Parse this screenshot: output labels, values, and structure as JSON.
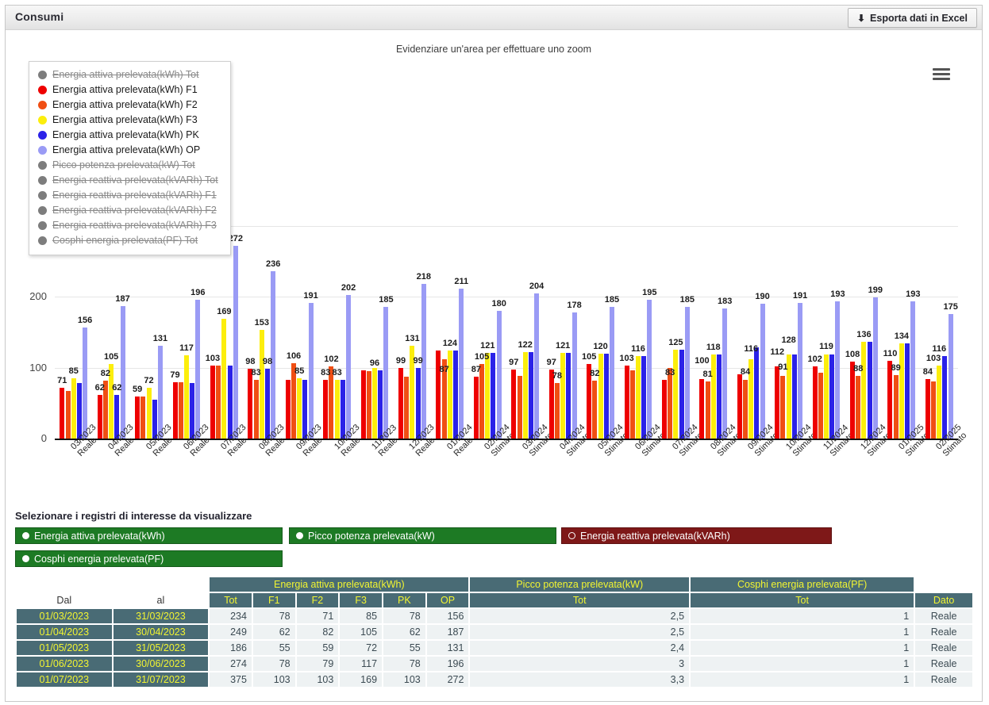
{
  "panel": {
    "title": "Consumi"
  },
  "toolbar": {
    "export_label": "Esporta dati in Excel",
    "export_icon": "download-icon",
    "menu_icon": "hamburger-menu-icon"
  },
  "chart_hint": "Evidenziare un'area per effettuare uno zoom",
  "legend": {
    "items": [
      {
        "label": "Energia attiva prelevata(kWh) Tot",
        "color": "#7d7d7d",
        "active": false
      },
      {
        "label": "Energia attiva prelevata(kWh) F1",
        "color": "#ee0000",
        "active": true
      },
      {
        "label": "Energia attiva prelevata(kWh) F2",
        "color": "#f04e13",
        "active": true
      },
      {
        "label": "Energia attiva prelevata(kWh) F3",
        "color": "#fcee0c",
        "active": true
      },
      {
        "label": "Energia attiva prelevata(kWh) PK",
        "color": "#2b22e8",
        "active": true
      },
      {
        "label": "Energia attiva prelevata(kWh) OP",
        "color": "#9a9bf5",
        "active": true
      },
      {
        "label": "Picco potenza prelevata(kW) Tot",
        "color": "#7d7d7d",
        "active": false
      },
      {
        "label": "Energia reattiva prelevata(kVARh) Tot",
        "color": "#7d7d7d",
        "active": false
      },
      {
        "label": "Energia reattiva prelevata(kVARh) F1",
        "color": "#7d7d7d",
        "active": false
      },
      {
        "label": "Energia reattiva prelevata(kVARh) F2",
        "color": "#7d7d7d",
        "active": false
      },
      {
        "label": "Energia reattiva prelevata(kVARh) F3",
        "color": "#7d7d7d",
        "active": false
      },
      {
        "label": "Cosphi energia prelevata(PF) Tot",
        "color": "#7d7d7d",
        "active": false
      }
    ]
  },
  "chart_data": {
    "type": "bar",
    "title": "",
    "xlabel": "",
    "ylabel": "",
    "ylim": [
      0,
      300
    ],
    "yticks": [
      0,
      100,
      200,
      300
    ],
    "grid": true,
    "legend_position": "top-left-overlay",
    "categories": [
      "03/2023\nReale",
      "04/2023\nReale",
      "05/2023\nReale",
      "06/2023\nReale",
      "07/2023\nReale",
      "08/2023\nReale",
      "09/2023\nReale",
      "10/2023\nReale",
      "11/2023\nReale",
      "12/2023\nReale",
      "01/2024\nReale",
      "02/2024\nStimato",
      "03/2024\nStimato",
      "04/2024\nStimato",
      "05/2024\nStimato",
      "06/2024\nStimato",
      "07/2024\nStimato",
      "08/2024\nStimato",
      "09/2024\nStimato",
      "10/2024\nStimato",
      "11/2024\nStimato",
      "12/2024\nStimato",
      "01/2025\nStimato",
      "02/2025\nStimato"
    ],
    "series": [
      {
        "name": "Energia attiva prelevata(kWh) F1",
        "color": "#ee0000",
        "values": [
          71,
          62,
          59,
          79,
          103,
          98,
          83,
          83,
          96,
          99,
          124,
          87,
          97,
          97,
          105,
          103,
          83,
          84,
          91,
          102,
          102,
          108,
          110,
          84
        ]
      },
      {
        "name": "Energia attiva prelevata(kWh) F2",
        "color": "#f04e13",
        "values": [
          67,
          82,
          59,
          79,
          103,
          83,
          106,
          102,
          95,
          87,
          112,
          105,
          88,
          78,
          82,
          96,
          100,
          81,
          83,
          88,
          93,
          88,
          89,
          80
        ]
      },
      {
        "name": "Energia attiva prelevata(kWh) F3",
        "color": "#fcee0c",
        "values": [
          85,
          105,
          72,
          117,
          169,
          153,
          85,
          83,
          99,
          131,
          124,
          121,
          122,
          121,
          120,
          116,
          125,
          118,
          112,
          119,
          119,
          136,
          134,
          103
        ]
      },
      {
        "name": "Energia attiva prelevata(kWh) PK",
        "color": "#2b22e8",
        "values": [
          78,
          62,
          55,
          78,
          103,
          98,
          83,
          83,
          96,
          99,
          124,
          121,
          122,
          121,
          120,
          116,
          125,
          118,
          128,
          119,
          119,
          136,
          134,
          116
        ]
      },
      {
        "name": "Energia attiva prelevata(kWh) OP",
        "color": "#9a9bf5",
        "values": [
          156,
          187,
          131,
          196,
          272,
          236,
          191,
          202,
          185,
          218,
          211,
          180,
          204,
          178,
          185,
          195,
          185,
          183,
          190,
          191,
          193,
          199,
          193,
          175
        ]
      }
    ],
    "visible_data_labels": [
      {
        "i": 0,
        "labels": [
          {
            "s": "F1",
            "v": 71
          },
          {
            "s": "F3",
            "v": 85
          },
          {
            "s": "OP",
            "v": 156
          }
        ]
      },
      {
        "i": 1,
        "labels": [
          {
            "s": "F1",
            "v": 62
          },
          {
            "s": "F2",
            "v": 82
          },
          {
            "s": "F3",
            "v": 105
          },
          {
            "s": "PK",
            "v": 62
          },
          {
            "s": "OP",
            "v": 187
          }
        ]
      },
      {
        "i": 2,
        "labels": [
          {
            "s": "F1",
            "v": 59
          },
          {
            "s": "F3",
            "v": 72
          },
          {
            "s": "OP",
            "v": 131
          }
        ]
      },
      {
        "i": 3,
        "labels": [
          {
            "s": "F1",
            "v": 79
          },
          {
            "s": "F3",
            "v": 117
          },
          {
            "s": "OP",
            "v": 196
          }
        ]
      },
      {
        "i": 4,
        "labels": [
          {
            "s": "F1",
            "v": 103
          },
          {
            "s": "F3",
            "v": 169
          },
          {
            "s": "OP",
            "v": 272
          }
        ]
      },
      {
        "i": 5,
        "labels": [
          {
            "s": "F1",
            "v": 98
          },
          {
            "s": "F2",
            "v": 83
          },
          {
            "s": "F3",
            "v": 153
          },
          {
            "s": "PK",
            "v": 98
          },
          {
            "s": "OP",
            "v": 236
          }
        ]
      },
      {
        "i": 6,
        "labels": [
          {
            "s": "F2",
            "v": 106
          },
          {
            "s": "F3",
            "v": 85
          },
          {
            "s": "OP",
            "v": 191
          }
        ]
      },
      {
        "i": 7,
        "labels": [
          {
            "s": "F1",
            "v": 83
          },
          {
            "s": "F2",
            "v": 102
          },
          {
            "s": "F3",
            "v": 83
          },
          {
            "s": "OP",
            "v": 202
          }
        ]
      },
      {
        "i": 8,
        "labels": [
          {
            "s": "F3",
            "v": 96
          },
          {
            "s": "OP",
            "v": 185
          }
        ]
      },
      {
        "i": 9,
        "labels": [
          {
            "s": "F1",
            "v": 99
          },
          {
            "s": "F3",
            "v": 131
          },
          {
            "s": "PK",
            "v": 99
          },
          {
            "s": "OP",
            "v": 218
          }
        ]
      },
      {
        "i": 10,
        "labels": [
          {
            "s": "F2",
            "v": 87
          },
          {
            "s": "F3",
            "v": 124
          },
          {
            "s": "OP",
            "v": 211
          }
        ]
      },
      {
        "i": 11,
        "labels": [
          {
            "s": "F1",
            "v": 87
          },
          {
            "s": "F2",
            "v": 105
          },
          {
            "s": "F3",
            "v": 121
          },
          {
            "s": "OP",
            "v": 180
          }
        ]
      },
      {
        "i": 12,
        "labels": [
          {
            "s": "F1",
            "v": 97
          },
          {
            "s": "F3",
            "v": 122
          },
          {
            "s": "OP",
            "v": 204
          }
        ]
      },
      {
        "i": 13,
        "labels": [
          {
            "s": "F1",
            "v": 97
          },
          {
            "s": "F2",
            "v": 78
          },
          {
            "s": "F3",
            "v": 121
          },
          {
            "s": "OP",
            "v": 178
          }
        ]
      },
      {
        "i": 14,
        "labels": [
          {
            "s": "F1",
            "v": 105
          },
          {
            "s": "F2",
            "v": 82
          },
          {
            "s": "F3",
            "v": 120
          },
          {
            "s": "OP",
            "v": 185
          }
        ]
      },
      {
        "i": 15,
        "labels": [
          {
            "s": "F1",
            "v": 103
          },
          {
            "s": "F3",
            "v": 116
          },
          {
            "s": "OP",
            "v": 195
          }
        ]
      },
      {
        "i": 16,
        "labels": [
          {
            "s": "F2",
            "v": 83
          },
          {
            "s": "F3",
            "v": 125
          },
          {
            "s": "OP",
            "v": 185
          }
        ]
      },
      {
        "i": 17,
        "labels": [
          {
            "s": "F1",
            "v": 100
          },
          {
            "s": "F2",
            "v": 81
          },
          {
            "s": "F3",
            "v": 118
          },
          {
            "s": "OP",
            "v": 183
          }
        ]
      },
      {
        "i": 18,
        "labels": [
          {
            "s": "F2",
            "v": 84
          },
          {
            "s": "F3",
            "v": 116
          },
          {
            "s": "OP",
            "v": 190
          }
        ]
      },
      {
        "i": 19,
        "labels": [
          {
            "s": "F1",
            "v": 112
          },
          {
            "s": "F2",
            "v": 91
          },
          {
            "s": "F3",
            "v": 128
          },
          {
            "s": "OP",
            "v": 191
          }
        ]
      },
      {
        "i": 20,
        "labels": [
          {
            "s": "F1",
            "v": 102
          },
          {
            "s": "F3",
            "v": 119
          },
          {
            "s": "OP",
            "v": 193
          }
        ]
      },
      {
        "i": 21,
        "labels": [
          {
            "s": "F1",
            "v": 108
          },
          {
            "s": "F2",
            "v": 88
          },
          {
            "s": "F3",
            "v": 136
          },
          {
            "s": "OP",
            "v": 199
          }
        ]
      },
      {
        "i": 22,
        "labels": [
          {
            "s": "F1",
            "v": 110
          },
          {
            "s": "F2",
            "v": 89
          },
          {
            "s": "F3",
            "v": 134
          },
          {
            "s": "OP",
            "v": 193
          }
        ]
      },
      {
        "i": 23,
        "labels": [
          {
            "s": "F1",
            "v": 84
          },
          {
            "s": "F2",
            "v": 103
          },
          {
            "s": "F3",
            "v": 116
          },
          {
            "s": "OP",
            "v": 175
          }
        ]
      }
    ]
  },
  "registers": {
    "title": "Selezionare i registri di interesse da visualizzare",
    "buttons": [
      {
        "label": "Energia attiva prelevata(kWh)",
        "color": "#1d7a24",
        "selected": true
      },
      {
        "label": "Picco potenza prelevata(kW)",
        "color": "#1d7a24",
        "selected": true
      },
      {
        "label": "Energia reattiva prelevata(kVARh)",
        "color": "#7e1818",
        "selected": false
      },
      {
        "label": "Cosphi energia prelevata(PF)",
        "color": "#1d7a24",
        "selected": true
      }
    ]
  },
  "table": {
    "group_headers": [
      {
        "label": "Energia attiva prelevata(kWh)"
      },
      {
        "label": "Picco potenza prelevata(kW)"
      },
      {
        "label": "Cosphi energia prelevata(PF)"
      }
    ],
    "col_dal": "Dal",
    "col_al": "al",
    "sub_headers": [
      "Tot",
      "F1",
      "F2",
      "F3",
      "PK",
      "OP"
    ],
    "col_picco": "Tot",
    "col_cosphi": "Tot",
    "col_dato": "Dato",
    "rows": [
      {
        "dal": "01/03/2023",
        "al": "31/03/2023",
        "tot": "234",
        "f1": "78",
        "f2": "71",
        "f3": "85",
        "pk": "78",
        "op": "156",
        "picco": "2,5",
        "cosphi": "1",
        "dato": "Reale"
      },
      {
        "dal": "01/04/2023",
        "al": "30/04/2023",
        "tot": "249",
        "f1": "62",
        "f2": "82",
        "f3": "105",
        "pk": "62",
        "op": "187",
        "picco": "2,5",
        "cosphi": "1",
        "dato": "Reale"
      },
      {
        "dal": "01/05/2023",
        "al": "31/05/2023",
        "tot": "186",
        "f1": "55",
        "f2": "59",
        "f3": "72",
        "pk": "55",
        "op": "131",
        "picco": "2,4",
        "cosphi": "1",
        "dato": "Reale"
      },
      {
        "dal": "01/06/2023",
        "al": "30/06/2023",
        "tot": "274",
        "f1": "78",
        "f2": "79",
        "f3": "117",
        "pk": "78",
        "op": "196",
        "picco": "3",
        "cosphi": "1",
        "dato": "Reale"
      },
      {
        "dal": "01/07/2023",
        "al": "31/07/2023",
        "tot": "375",
        "f1": "103",
        "f2": "103",
        "f3": "169",
        "pk": "103",
        "op": "272",
        "picco": "3,3",
        "cosphi": "1",
        "dato": "Reale"
      }
    ]
  }
}
